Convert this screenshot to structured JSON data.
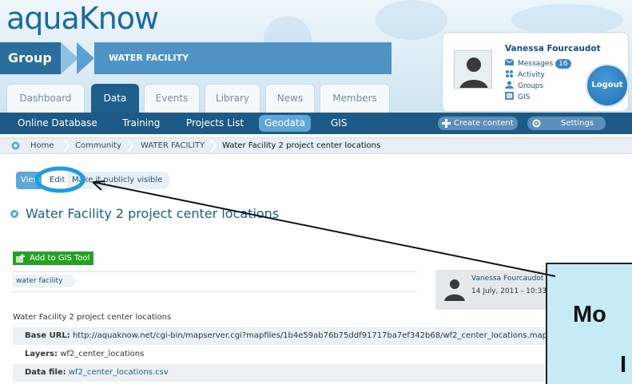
{
  "header": {
    "logo": "aquaKnow",
    "group_label": "Group",
    "group_name": "WATER FACILITY"
  },
  "tabs": [
    {
      "label": "Dashboard",
      "active": false
    },
    {
      "label": "Data",
      "active": true
    },
    {
      "label": "Events",
      "active": false
    },
    {
      "label": "Library",
      "active": false
    },
    {
      "label": "News",
      "active": false
    },
    {
      "label": "Members",
      "active": false
    }
  ],
  "user": {
    "name": "Vanessa Fourcaudot",
    "messages_label": "Messages",
    "messages_count": "16",
    "activity_label": "Activity",
    "groups_label": "Groups",
    "gis_label": "GIS",
    "logout_label": "Logout"
  },
  "nav": {
    "items": [
      "Online Database",
      "Training",
      "Projects List",
      "Geodata",
      "GIS"
    ],
    "active": "Geodata",
    "create_label": "Create content",
    "settings_label": "Settings"
  },
  "breadcrumb": [
    "Home",
    "Community",
    "WATER FACILITY",
    "Water Facility 2 project center locations"
  ],
  "subtabs": {
    "view": "View",
    "edit": "Edit",
    "visible": "Make it publicly visible"
  },
  "page_title": "Water Facility 2 project center locations",
  "gis_button": "Add to GIS Tool",
  "tag": "water facility",
  "author": {
    "name": "Vanessa Fourcaudot",
    "date": "14 July, 2011 - 10:33"
  },
  "description": "Water Facility 2 project center locations",
  "fields": {
    "base_url_label": "Base URL:",
    "base_url_value": "http://aquaknow.net/cgi-bin/mapserver.cgi?mapfiles/1b4e59ab76b75ddf91717ba7ef342b68/wf2_center_locations.map",
    "layers_label": "Layers:",
    "layers_value": "wf2_center_locations",
    "datafile_label": "Data file:",
    "datafile_value": "wf2_center_locations.csv"
  },
  "annotation": {
    "callout_line1": "Mo",
    "callout_line2": "I"
  },
  "colors": {
    "nav_bg": "#1d5a85",
    "accent": "#5ea7d6",
    "title": "#1b5c8a",
    "gis_green": "#26a026",
    "callout_bg": "#c6ebf7",
    "highlight_circle": "#1e9de0"
  }
}
